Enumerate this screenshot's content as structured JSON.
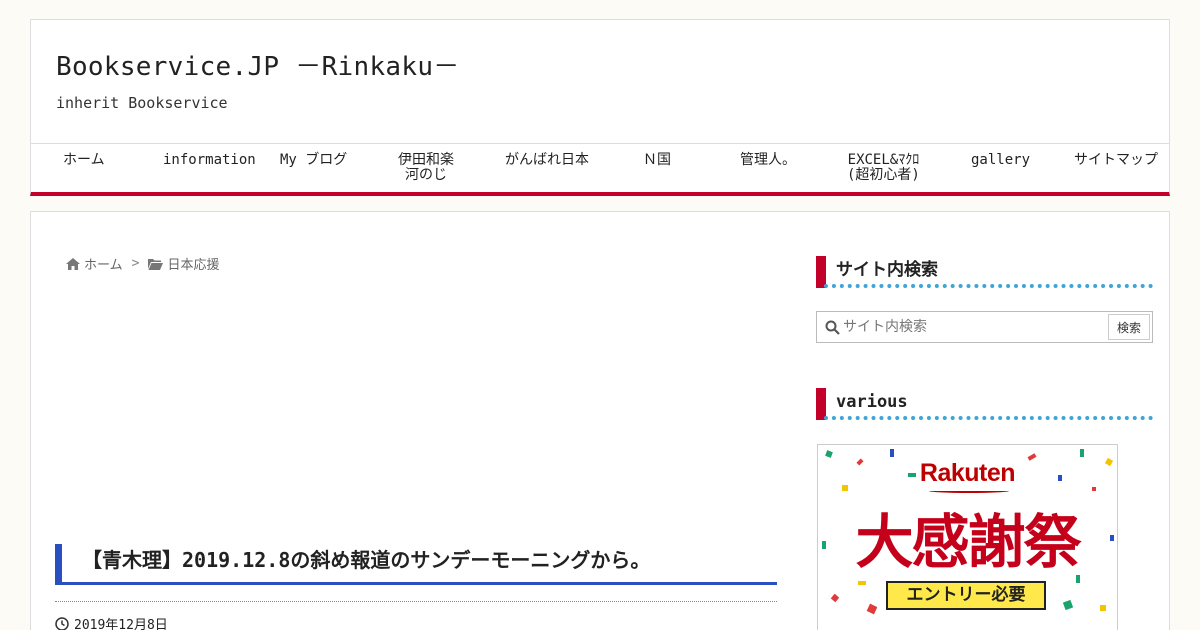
{
  "site": {
    "title": "Bookservice.JP －Rinkaku－",
    "tagline": "inherit Bookservice"
  },
  "nav": {
    "items": [
      {
        "label": "ホーム"
      },
      {
        "label": "information"
      },
      {
        "label": "My ブログ"
      },
      {
        "label": "伊田和楽\n河のじ"
      },
      {
        "label": "がんばれ日本"
      },
      {
        "label": "Ｎ国"
      },
      {
        "label": "管理人。"
      },
      {
        "label": "EXCEL&ﾏｸﾛ\n(超初心者)"
      },
      {
        "label": "gallery"
      },
      {
        "label": "サイトマップ"
      }
    ],
    "accent_color": "#c2002a"
  },
  "breadcrumb": {
    "home_icon": "home-icon",
    "home": "ホーム",
    "folder_icon": "folder-icon",
    "category": "日本応援"
  },
  "article": {
    "title": "【青木理】2019.12.8の斜め報道のサンデーモーニングから。",
    "date_icon": "clock-icon",
    "date": "2019年12月8日",
    "accent_color": "#2a4fc0"
  },
  "sidebar": {
    "search_widget": {
      "title": "サイト内検索",
      "placeholder": "サイト内検索",
      "button": "検索",
      "icon": "search-icon"
    },
    "various_widget": {
      "title": "various"
    },
    "banner": {
      "brand": "Rakuten",
      "main": "大感謝祭",
      "entry": "エントリー必要"
    }
  }
}
